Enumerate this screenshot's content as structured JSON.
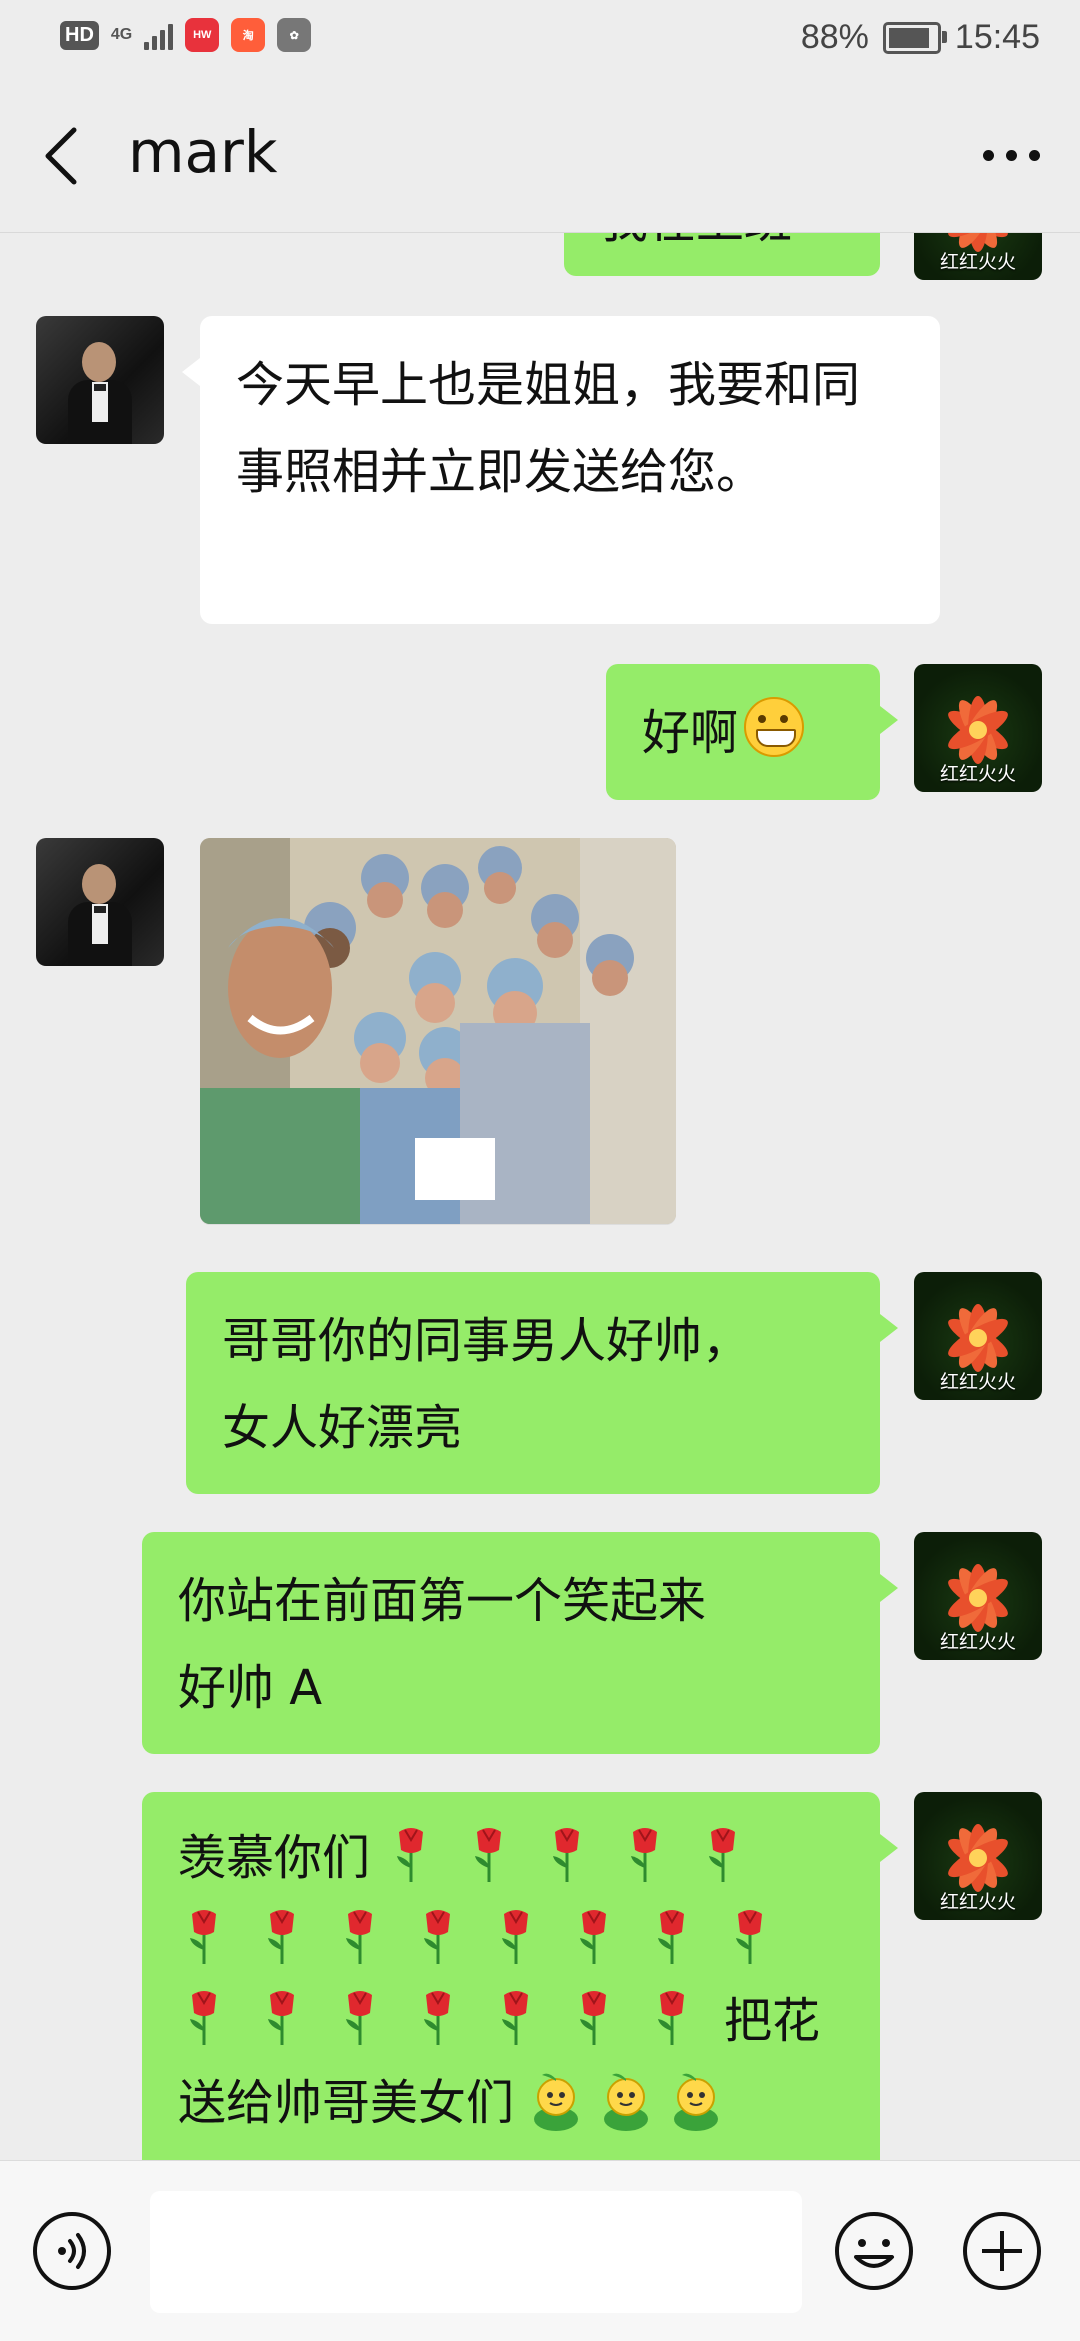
{
  "status_bar": {
    "hd": "HD",
    "network": "4G",
    "battery_percent": "88%",
    "battery_level": 0.88,
    "time": "15:45",
    "app_icons": [
      "huawei-app-icon",
      "taobao-app-icon",
      "baidu-paw-icon"
    ]
  },
  "nav": {
    "title": "mark",
    "back_icon": "chevron-left-icon",
    "more_icon": "more-dots-icon"
  },
  "avatars": {
    "mark": "avatar-man-in-tuxedo",
    "me_caption": "红红火火"
  },
  "messages": [
    {
      "side": "out",
      "text": "我在上班",
      "partially_visible": true
    },
    {
      "side": "in",
      "text": "今天早上也是姐姐，我要和同事照相并立即发送给您。"
    },
    {
      "side": "out",
      "text": "好啊",
      "emoji": "grinning-face-icon"
    },
    {
      "side": "in",
      "type": "image",
      "description_icon": "group-photo-medical-staff"
    },
    {
      "side": "out",
      "text_lines": [
        "哥哥你的同事男人好帅，",
        "女人好漂亮"
      ]
    },
    {
      "side": "out",
      "text_lines": [
        "你站在前面第一个笑起来",
        "好帅 A"
      ]
    },
    {
      "side": "out",
      "text_lines": [
        "羡慕你们",
        "把花",
        "送给帅哥美女们"
      ],
      "emoji": "rose-icon",
      "emoji2": "sprout-icon"
    }
  ],
  "input": {
    "placeholder": "",
    "voice_icon": "voice-icon",
    "emoji_icon": "smiley-icon",
    "plus_icon": "plus-icon"
  },
  "colors": {
    "background": "#ededed",
    "bubble_out": "#95ec69",
    "bubble_in": "#ffffff"
  }
}
